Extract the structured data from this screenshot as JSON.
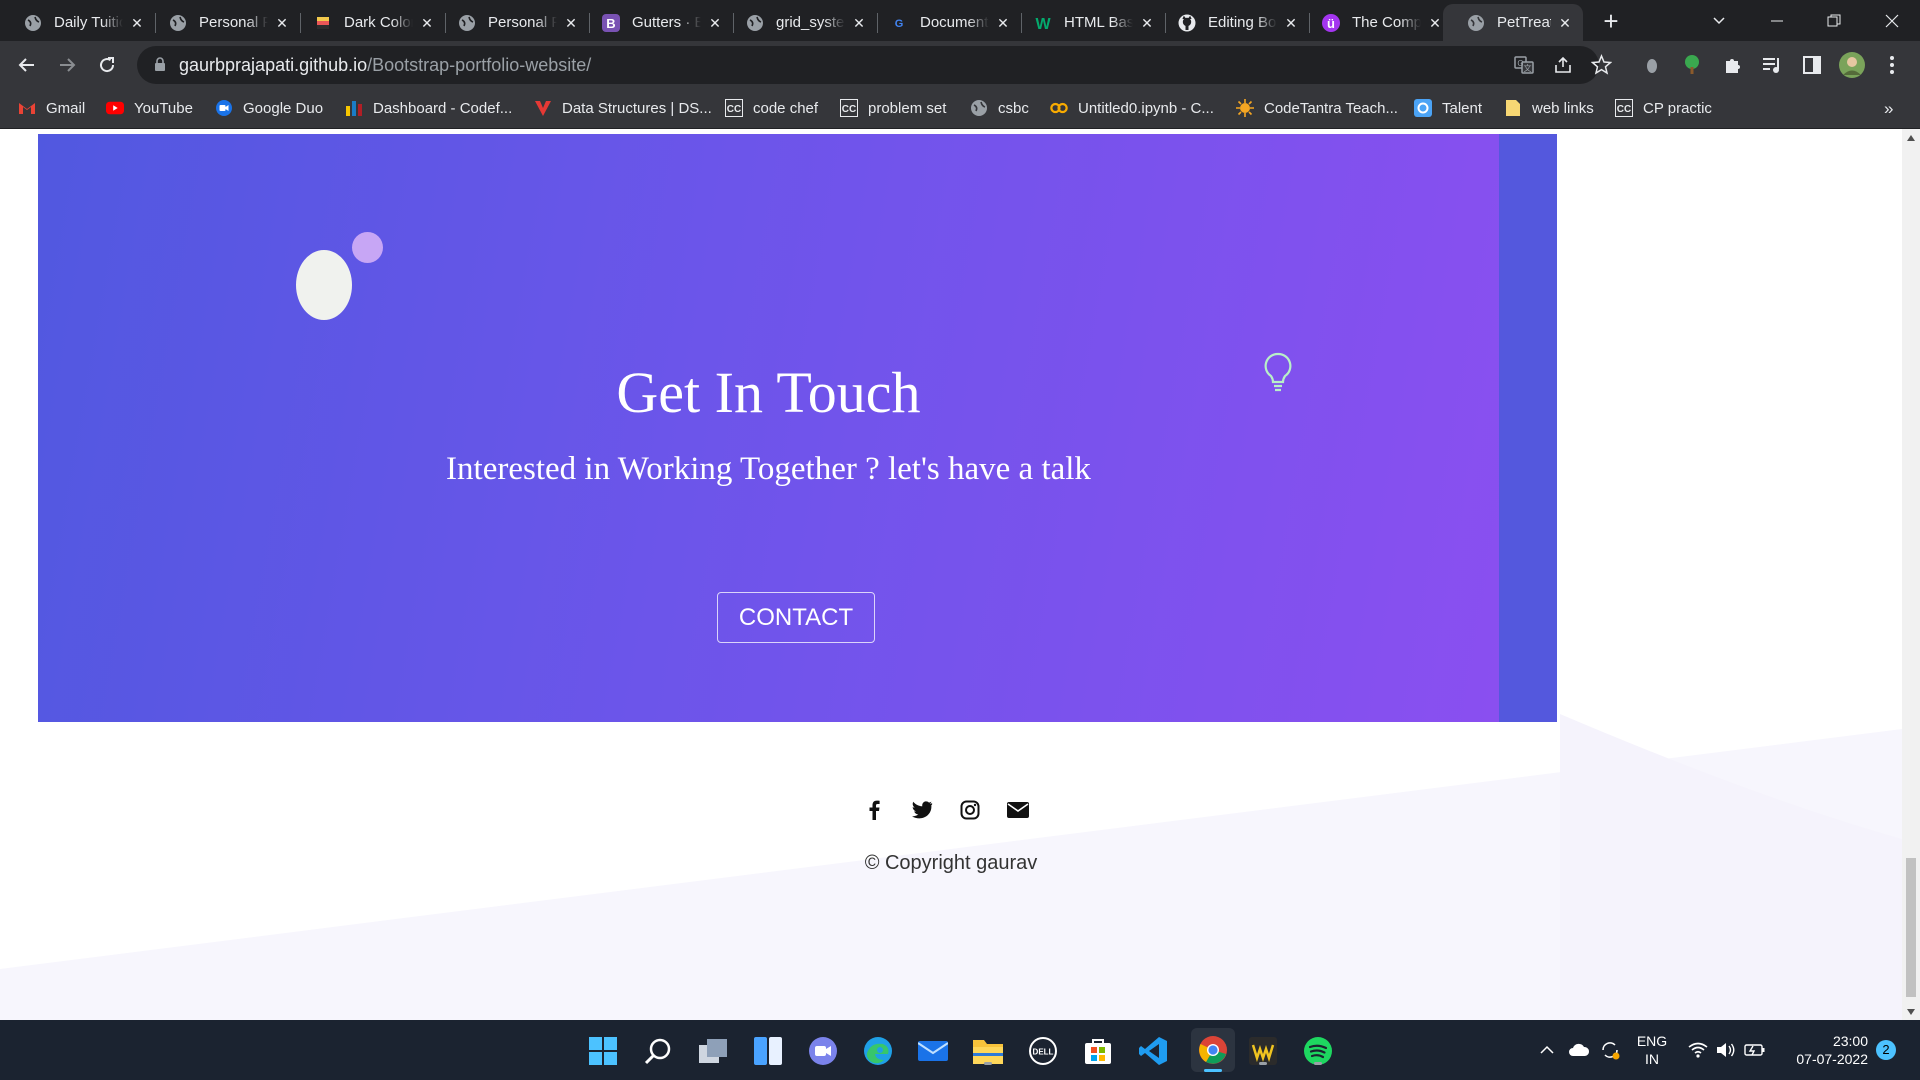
{
  "browser": {
    "tabs": [
      {
        "title": "Daily Tuition",
        "icon": "globe-icon"
      },
      {
        "title": "Personal Portfolio",
        "icon": "globe-icon"
      },
      {
        "title": "Dark Color",
        "icon": "colors-icon"
      },
      {
        "title": "Personal Portfolio",
        "icon": "globe-icon"
      },
      {
        "title": "Gutters · Bootstrap",
        "icon": "bootstrap-icon"
      },
      {
        "title": "grid_system",
        "icon": "globe-icon"
      },
      {
        "title": "Document",
        "icon": "google-icon"
      },
      {
        "title": "HTML Basics",
        "icon": "w-icon"
      },
      {
        "title": "Editing Bootstrap",
        "icon": "github-icon"
      },
      {
        "title": "The Complete",
        "icon": "u-icon"
      },
      {
        "title": "PetTreat",
        "icon": "globe-icon",
        "active": true
      }
    ],
    "url_host": "gaurbprajapati.github.io",
    "url_path": "/Bootstrap-portfolio-website/",
    "bookmarks": [
      {
        "label": "Gmail",
        "icon": "gmail-icon"
      },
      {
        "label": "YouTube",
        "icon": "youtube-icon"
      },
      {
        "label": "Google Duo",
        "icon": "duo-icon"
      },
      {
        "label": "Dashboard - Codef...",
        "icon": "codeforces-icon"
      },
      {
        "label": "Data Structures | DS...",
        "icon": "vertex-icon"
      },
      {
        "label": "code chef",
        "icon": "cc-icon"
      },
      {
        "label": "problem set",
        "icon": "cc-icon"
      },
      {
        "label": "csbc",
        "icon": "globe-icon"
      },
      {
        "label": "Untitled0.ipynb - C...",
        "icon": "colab-icon"
      },
      {
        "label": "CodeTantra Teach...",
        "icon": "codetantra-icon"
      },
      {
        "label": "Talent",
        "icon": "talent-icon"
      },
      {
        "label": "web links",
        "icon": "folder-icon"
      },
      {
        "label": "CP practic",
        "icon": "cc-icon"
      }
    ],
    "more_bookmarks": "»"
  },
  "page": {
    "contact": {
      "title": "Get In Touch",
      "subtitle": "Interested in Working Together ? let's have a talk",
      "button": "CONTACT"
    },
    "footer": {
      "socials": [
        "facebook-icon",
        "twitter-icon",
        "instagram-icon",
        "email-icon"
      ],
      "copyright": "© Copyright gaurav"
    },
    "colors": {
      "contact_gradient_start": "#5158e0",
      "contact_gradient_end": "#8a4ff0",
      "blob_light": "#f0f2ee",
      "blob_lilac": "#c7a6f5",
      "bulb_stroke": "#b8f0c8"
    }
  },
  "taskbar": {
    "apps": [
      "windows-start-icon",
      "search-icon",
      "task-view-icon",
      "widgets-icon",
      "teams-chat-icon",
      "edge-icon",
      "mail-icon",
      "file-explorer-icon",
      "dell-icon",
      "store-icon",
      "vscode-icon",
      "chrome-icon",
      "winamp-icon",
      "spotify-icon"
    ],
    "lang_top": "ENG",
    "lang_bottom": "IN",
    "time": "23:00",
    "date": "07-07-2022",
    "notifications": "2"
  }
}
